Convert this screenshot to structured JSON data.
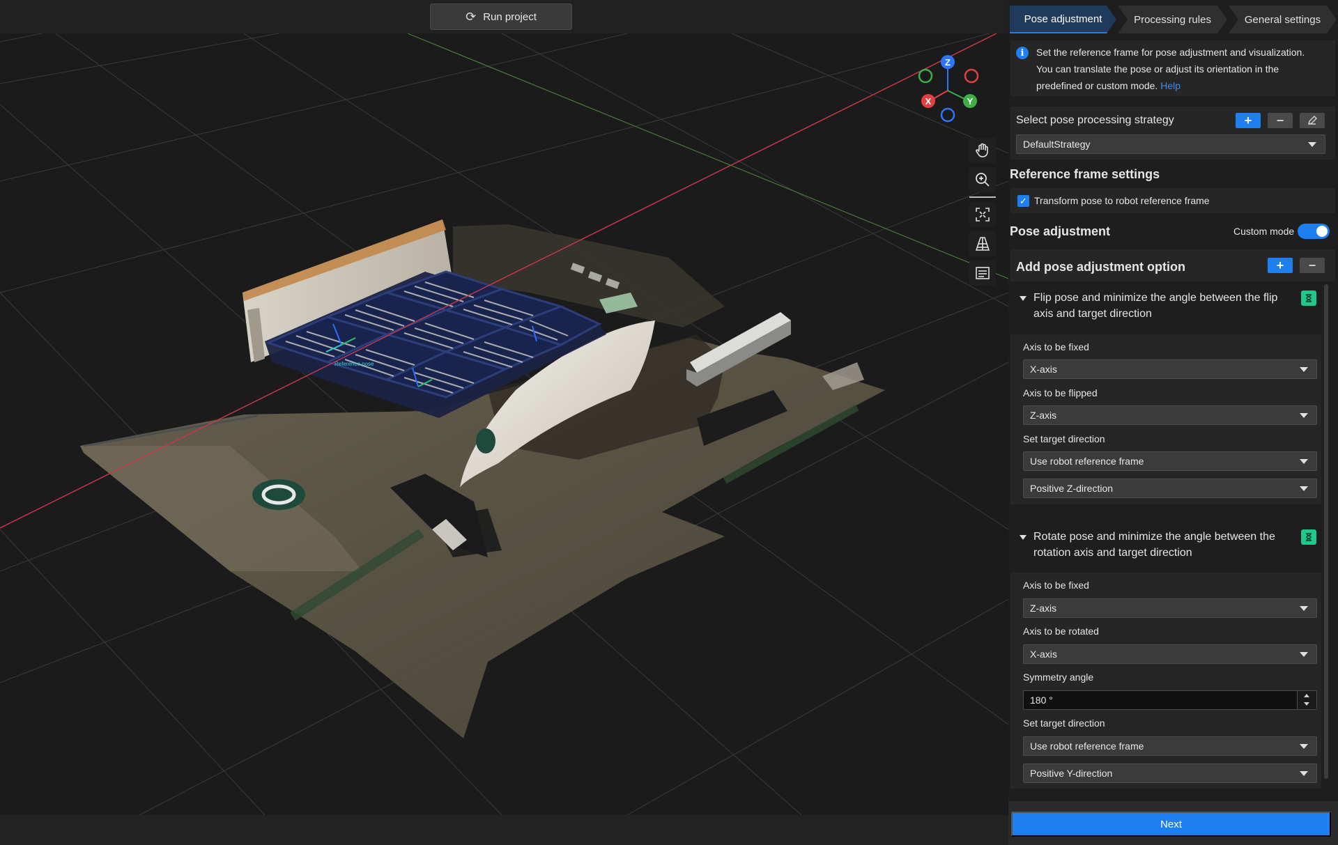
{
  "toolbar": {
    "run_project_label": "Run project"
  },
  "gizmo": {
    "z": "Z",
    "x": "X",
    "y": "Y"
  },
  "viewport_tools": [
    "hand-icon",
    "zoom-icon",
    "fit-view-icon",
    "perspective-icon",
    "list-icon"
  ],
  "scene": {
    "label_text": "Reference pose"
  },
  "tabs": [
    {
      "label": "Pose adjustment",
      "active": true
    },
    {
      "label": "Processing rules",
      "active": false
    },
    {
      "label": "General settings",
      "active": false
    }
  ],
  "info": {
    "line1": "Set the reference frame for pose adjustment and visualization.",
    "line2": "You can translate the pose or adjust its orientation in the",
    "line3": "predefined or custom mode.",
    "help_link": "Help"
  },
  "strategy": {
    "label": "Select pose processing strategy",
    "value": "DefaultStrategy"
  },
  "reference_frame": {
    "heading": "Reference frame settings",
    "checkbox_label": "Transform pose to robot reference frame",
    "checked": true
  },
  "pose_adjustment": {
    "heading": "Pose adjustment",
    "custom_mode_label": "Custom mode",
    "custom_mode_on": true,
    "add_option_label": "Add pose adjustment option"
  },
  "options": [
    {
      "title_line1": "Flip pose and minimize the angle between the flip",
      "title_line2": "axis and target direction",
      "fields": [
        {
          "label": "Axis to be fixed",
          "value": "X-axis"
        },
        {
          "label": "Axis to be flipped",
          "value": "Z-axis"
        },
        {
          "label": "Set target direction",
          "value": "Use robot reference frame",
          "value2": "Positive Z-direction"
        }
      ]
    },
    {
      "title_line1": "Rotate pose and minimize the angle between the",
      "title_line2": "rotation axis and target direction",
      "fields": [
        {
          "label": "Axis to be fixed",
          "value": "Z-axis"
        },
        {
          "label": "Axis to be rotated",
          "value": "X-axis"
        },
        {
          "label": "Symmetry angle",
          "value": "180 °"
        },
        {
          "label": "Set target direction",
          "value": "Use robot reference frame",
          "value2": "Positive Y-direction"
        }
      ]
    }
  ],
  "footer": {
    "next_label": "Next"
  },
  "colors": {
    "accent": "#1e7ff0",
    "panel_bg": "#1e1e1e",
    "section_bg": "#262626",
    "success": "#20c98a"
  }
}
